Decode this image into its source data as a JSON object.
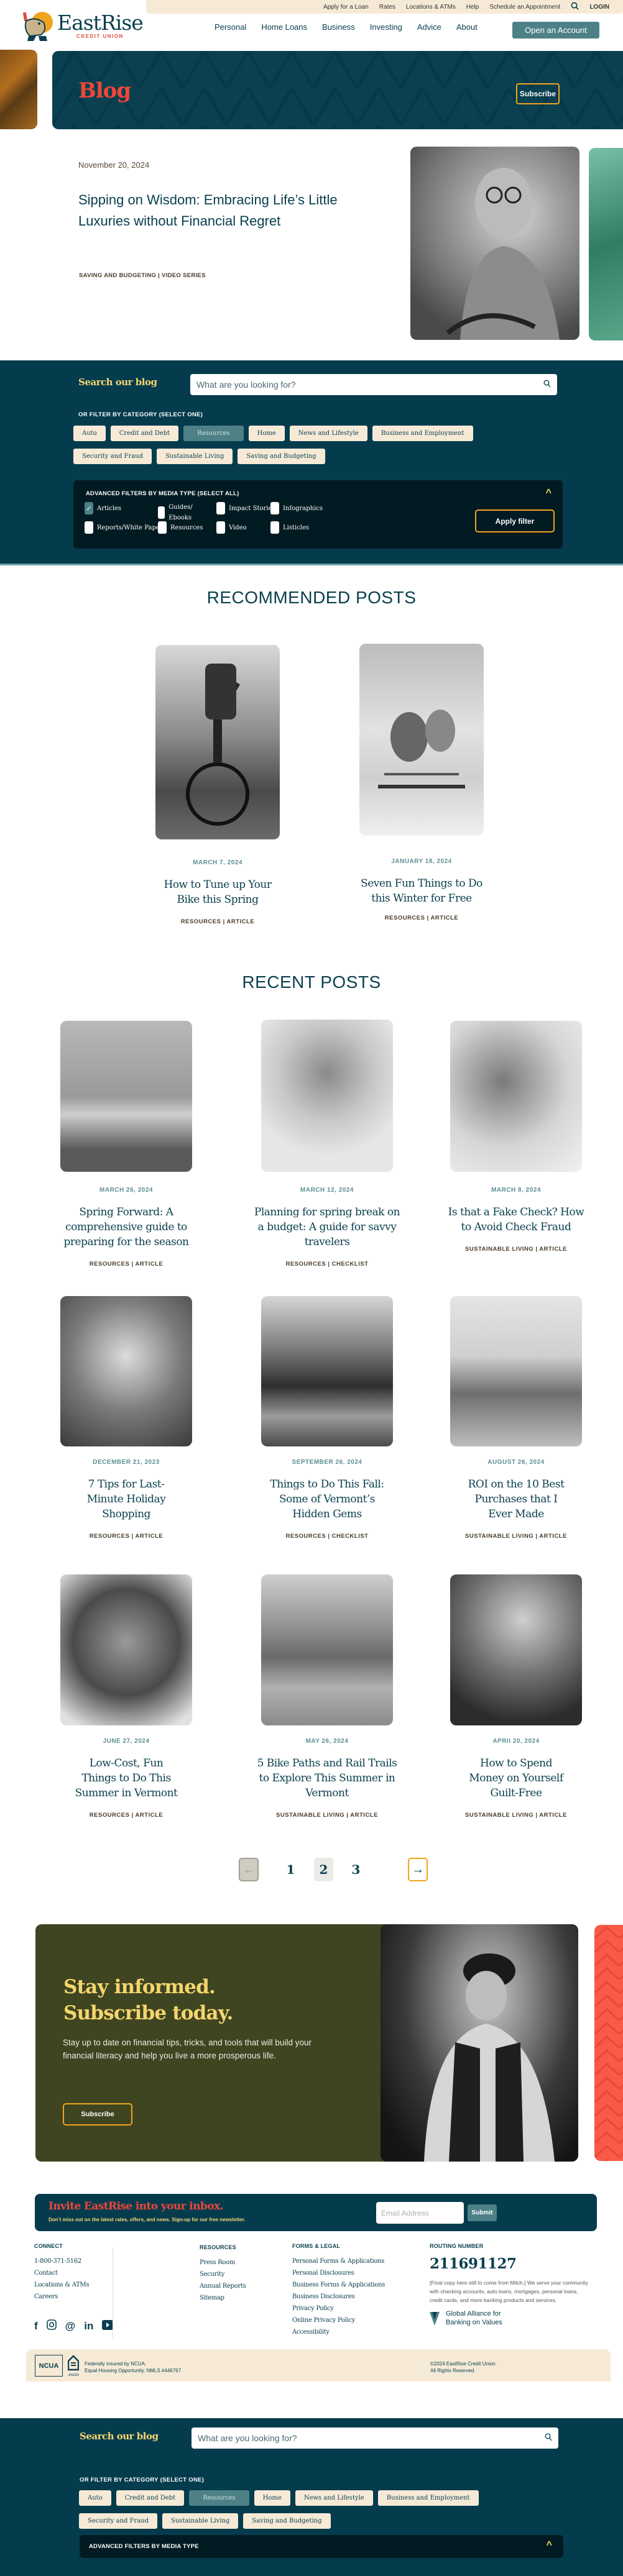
{
  "header": {
    "utility_links": [
      "Apply for a Loan",
      "Rates",
      "Locations & ATMs",
      "Help",
      "Schedule an Appointment"
    ],
    "login_label": "LOGIN",
    "logo_name": "EastRise",
    "logo_sub": "CREDIT UNION",
    "nav": [
      "Personal",
      "Home Loans",
      "Business",
      "Investing",
      "Advice",
      "About"
    ],
    "cta_label": "Open an Account"
  },
  "hero": {
    "title": "Blog",
    "subscribe_label": "Subscribe"
  },
  "featured": {
    "date": "November 20, 2024",
    "title": "Sipping on Wisdom: Embracing Life’s Little Luxuries without Financial Regret",
    "tags": "SAVING AND BUDGETING  |  VIDEO SERIES"
  },
  "search": {
    "label": "Search our blog",
    "placeholder": "What are you looking for?",
    "category_label": "OR FILTER BY CATEGORY (SELECT ONE)",
    "categories": [
      "Auto",
      "Credit and Debt",
      "Resources",
      "Home",
      "News and Lifestyle",
      "Business and Employment",
      "Security and Fraud",
      "Sustainable Living",
      "Saving and Budgeting"
    ],
    "active_category": "Resources",
    "advanced_title": "ADVANCED FILTERS BY MEDIA TYPE (SELECT ALL)",
    "advanced_title_collapsed": "ADVANCED FILTERS BY MEDIA TYPE",
    "media_types": [
      {
        "label": "Articles",
        "checked": true
      },
      {
        "label": "Guides/ Ebooks",
        "checked": false
      },
      {
        "label": "Impact Stories",
        "checked": false
      },
      {
        "label": "Infographics",
        "checked": false
      },
      {
        "label": "Reports/White Papers",
        "checked": false
      },
      {
        "label": "Resources",
        "checked": false
      },
      {
        "label": "Video",
        "checked": false
      },
      {
        "label": "Listicles",
        "checked": false
      }
    ],
    "apply_label": "Apply filter"
  },
  "recommended": {
    "heading": "RECOMMENDED POSTS",
    "posts": [
      {
        "date": "MARCH 7, 2024",
        "title": "How to Tune up Your Bike this Spring",
        "tags": "RESOURCES  |  ARTICLE"
      },
      {
        "date": "JANUARY 18, 2024",
        "title": "Seven Fun Things to Do this Winter for Free",
        "tags": "RESOURCES  |  ARTICLE"
      }
    ]
  },
  "recent": {
    "heading": "RECENT POSTS",
    "posts": [
      {
        "date": "MARCH 26, 2024",
        "title": "Spring Forward: A comprehensive guide to preparing for the season",
        "tags": "RESOURCES  |  ARTICLE"
      },
      {
        "date": "MARCH 12, 2024",
        "title": "Planning for spring break on a budget: A guide for savvy travelers",
        "tags": "RESOURCES  |  CHECKLIST"
      },
      {
        "date": "MARCH 8, 2024",
        "title": "Is that a Fake Check? How to Avoid Check Fraud",
        "tags": "SUSTAINABLE LIVING  |  ARTICLE"
      },
      {
        "date": "DECEMBER 21, 2023",
        "title": "7 Tips for Last-Minute Holiday Shopping",
        "tags": "RESOURCES  |  ARTICLE"
      },
      {
        "date": "SEPTEMBER 26, 2024",
        "title": "Things to Do This Fall: Some of Vermont’s Hidden Gems",
        "tags": "RESOURCES  |  CHECKLIST"
      },
      {
        "date": "AUGUST 26, 2024",
        "title": "ROI on the 10 Best Purchases that I Ever Made",
        "tags": "SUSTAINABLE LIVING  |  ARTICLE"
      },
      {
        "date": "JUNE 27, 2024",
        "title": "Low-Cost, Fun Things to Do This Summer in Vermont",
        "tags": "RESOURCES  |  ARTICLE"
      },
      {
        "date": "MAY 26, 2024",
        "title": "5 Bike Paths and Rail Trails to Explore This Summer in Vermont",
        "tags": "SUSTAINABLE LIVING  |  ARTICLE"
      },
      {
        "date": "APRII 20, 2024",
        "title": "How to Spend Money on Yourself Guilt-Free",
        "tags": "SUSTAINABLE LIVING  |  ARTICLE"
      }
    ]
  },
  "pagination": {
    "pages": [
      "1",
      "2",
      "3"
    ],
    "current": "2",
    "prev_icon": "←",
    "next_icon": "→"
  },
  "promo": {
    "title_line1": "Stay informed.",
    "title_line2": "Subscribe today.",
    "text": "Stay up to date on financial tips, tricks, and tools that will build your financial literacy and help you live a more prosperous life.",
    "button_label": "Subscribe"
  },
  "newsletter": {
    "title": "Invite EastRise into your inbox.",
    "subtitle": "Don’t miss out on the latest rates, offers, and news. Sign-up for our free newsletter.",
    "placeholder": "Email Address",
    "submit_label": "Submit"
  },
  "footer": {
    "connect": {
      "heading": "CONNECT",
      "links": [
        "1-800-371-5162",
        "Contact",
        "Locations & ATMs",
        "Careers"
      ]
    },
    "social": [
      "facebook",
      "instagram",
      "threads",
      "linkedin",
      "youtube"
    ],
    "resources": {
      "heading": "RESOURCES",
      "links": [
        "Press Room",
        "Security",
        "Annual Reports",
        "Sitemap"
      ]
    },
    "forms": {
      "heading": "FORMS & LEGAL",
      "links": [
        "Personal Forms & Applications",
        "Personal Disclosures",
        "Business Forms & Applications",
        "Business Disclosures",
        "Privacy Policy",
        "Online Privacy Policy",
        "Accessibility"
      ]
    },
    "routing": {
      "heading": "ROUTING NUMBER",
      "number": "211691127",
      "description": "[Final copy here still to come from Mitch.] We serve your community with checking accounts, auto loans, mortgages, personal loans, credit cards, and more banking products and services.",
      "gabv_line1": "Global Alliance for",
      "gabv_line2": "Banking on Values"
    },
    "legal": {
      "ncua": "NCUA",
      "ehl": "LENDER",
      "line1": "Federally insured by NCUA.",
      "line2": "Equal Housing Opportunity. NMLS #446767",
      "copy1": "©2024 EastRise Credit Union.",
      "copy2": "All Rights Reserved."
    }
  },
  "colors": {
    "brand_teal": "#0b4050",
    "accent_red": "#ef473a",
    "accent_yellow": "#f5d56f",
    "accent_orange": "#f0a41e",
    "chip_bg": "#f6ead7",
    "button_teal": "#4e8187",
    "promo_olive": "#3f4520"
  }
}
